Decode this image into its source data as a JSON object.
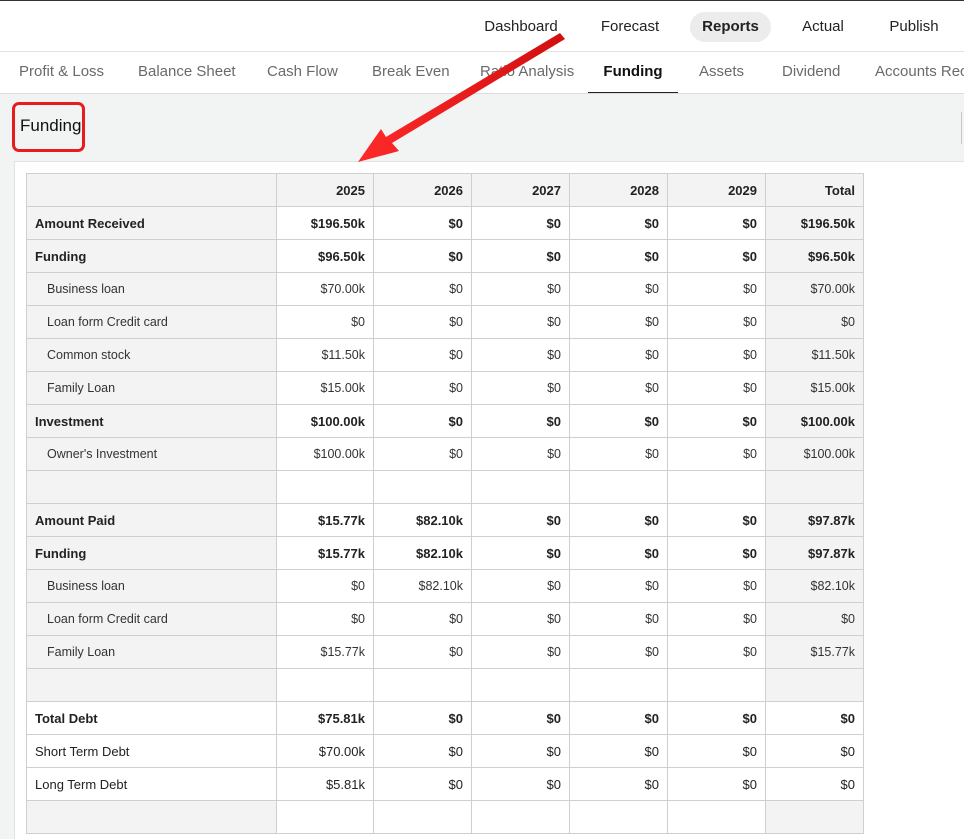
{
  "topnav": {
    "items": [
      {
        "label": "Dashboard"
      },
      {
        "label": "Forecast"
      },
      {
        "label": "Reports"
      },
      {
        "label": "Actual"
      },
      {
        "label": "Publish"
      }
    ]
  },
  "tabs": {
    "items": [
      {
        "label": "Profit & Loss"
      },
      {
        "label": "Balance Sheet"
      },
      {
        "label": "Cash Flow"
      },
      {
        "label": "Break Even"
      },
      {
        "label": "Ratio Analysis"
      },
      {
        "label": "Funding"
      },
      {
        "label": "Assets"
      },
      {
        "label": "Dividend"
      },
      {
        "label": "Accounts Rece"
      }
    ]
  },
  "section": {
    "title": "Funding"
  },
  "table": {
    "headers": [
      "",
      "2025",
      "2026",
      "2027",
      "2028",
      "2029",
      "Total"
    ],
    "rows": [
      {
        "label": "Amount Received",
        "values": [
          "$196.50k",
          "$0",
          "$0",
          "$0",
          "$0",
          "$196.50k"
        ]
      },
      {
        "label": "Funding",
        "values": [
          "$96.50k",
          "$0",
          "$0",
          "$0",
          "$0",
          "$96.50k"
        ]
      },
      {
        "label": "Business loan",
        "values": [
          "$70.00k",
          "$0",
          "$0",
          "$0",
          "$0",
          "$70.00k"
        ]
      },
      {
        "label": "Loan form Credit card",
        "values": [
          "$0",
          "$0",
          "$0",
          "$0",
          "$0",
          "$0"
        ]
      },
      {
        "label": "Common stock",
        "values": [
          "$11.50k",
          "$0",
          "$0",
          "$0",
          "$0",
          "$11.50k"
        ]
      },
      {
        "label": "Family Loan",
        "values": [
          "$15.00k",
          "$0",
          "$0",
          "$0",
          "$0",
          "$15.00k"
        ]
      },
      {
        "label": "Investment",
        "values": [
          "$100.00k",
          "$0",
          "$0",
          "$0",
          "$0",
          "$100.00k"
        ]
      },
      {
        "label": "Owner's Investment",
        "values": [
          "$100.00k",
          "$0",
          "$0",
          "$0",
          "$0",
          "$100.00k"
        ]
      },
      {
        "label": "",
        "values": [
          "",
          "",
          "",
          "",
          "",
          ""
        ]
      },
      {
        "label": "Amount Paid",
        "values": [
          "$15.77k",
          "$82.10k",
          "$0",
          "$0",
          "$0",
          "$97.87k"
        ]
      },
      {
        "label": "Funding",
        "values": [
          "$15.77k",
          "$82.10k",
          "$0",
          "$0",
          "$0",
          "$97.87k"
        ]
      },
      {
        "label": "Business loan",
        "values": [
          "$0",
          "$82.10k",
          "$0",
          "$0",
          "$0",
          "$82.10k"
        ]
      },
      {
        "label": "Loan form Credit card",
        "values": [
          "$0",
          "$0",
          "$0",
          "$0",
          "$0",
          "$0"
        ]
      },
      {
        "label": "Family Loan",
        "values": [
          "$15.77k",
          "$0",
          "$0",
          "$0",
          "$0",
          "$15.77k"
        ]
      },
      {
        "label": "",
        "values": [
          "",
          "",
          "",
          "",
          "",
          ""
        ]
      },
      {
        "label": "Total Debt",
        "values": [
          "$75.81k",
          "$0",
          "$0",
          "$0",
          "$0",
          "$0"
        ]
      },
      {
        "label": "Short Term Debt",
        "values": [
          "$70.00k",
          "$0",
          "$0",
          "$0",
          "$0",
          "$0"
        ]
      },
      {
        "label": "Long Term Debt",
        "values": [
          "$5.81k",
          "$0",
          "$0",
          "$0",
          "$0",
          "$0"
        ]
      },
      {
        "label": "",
        "values": [
          "",
          "",
          "",
          "",
          "",
          ""
        ]
      }
    ]
  },
  "colors": {
    "accent_red": "#e81c1c",
    "active_pill": "#ececec"
  }
}
